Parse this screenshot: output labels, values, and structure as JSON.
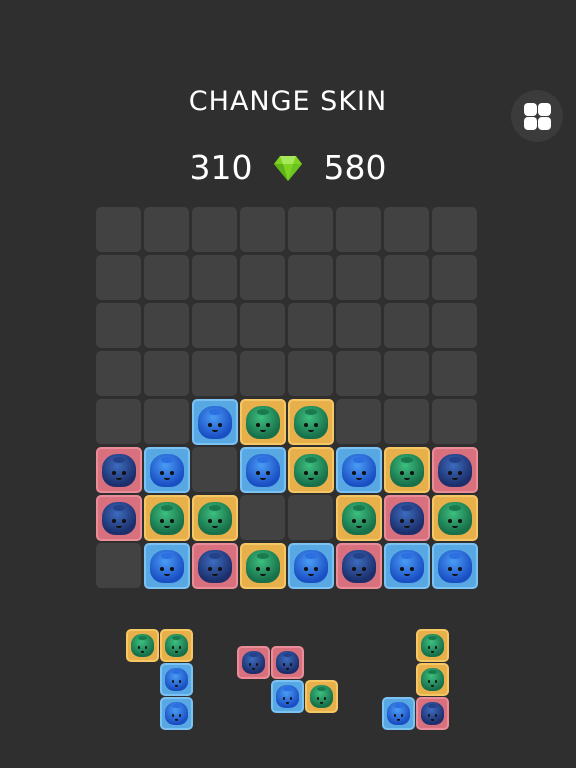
{
  "header": {
    "title": "CHANGE SKIN",
    "menu_icon": "grid-four-squares-icon",
    "left_score": "310",
    "gem_icon": "green-gem-icon",
    "right_score": "580"
  },
  "board": {
    "rows": 8,
    "cols": 8,
    "empty_cell_color": "#424242",
    "tiles": [
      {
        "row": 4,
        "col": 2,
        "skin": "blue-on-blue"
      },
      {
        "row": 4,
        "col": 3,
        "skin": "green-on-yellow"
      },
      {
        "row": 4,
        "col": 4,
        "skin": "green-on-yellow"
      },
      {
        "row": 5,
        "col": 0,
        "skin": "navy-on-pink"
      },
      {
        "row": 5,
        "col": 1,
        "skin": "blue-on-blue"
      },
      {
        "row": 5,
        "col": 3,
        "skin": "blue-on-blue"
      },
      {
        "row": 5,
        "col": 4,
        "skin": "green-on-yellow"
      },
      {
        "row": 5,
        "col": 5,
        "skin": "blue-on-blue"
      },
      {
        "row": 5,
        "col": 6,
        "skin": "green-on-yellow"
      },
      {
        "row": 5,
        "col": 7,
        "skin": "navy-on-pink"
      },
      {
        "row": 6,
        "col": 0,
        "skin": "navy-on-pink"
      },
      {
        "row": 6,
        "col": 1,
        "skin": "green-on-yellow"
      },
      {
        "row": 6,
        "col": 2,
        "skin": "green-on-yellow"
      },
      {
        "row": 6,
        "col": 5,
        "skin": "green-on-yellow"
      },
      {
        "row": 6,
        "col": 6,
        "skin": "navy-on-pink"
      },
      {
        "row": 6,
        "col": 7,
        "skin": "green-on-yellow"
      },
      {
        "row": 7,
        "col": 1,
        "skin": "blue-on-blue"
      },
      {
        "row": 7,
        "col": 2,
        "skin": "navy-on-pink"
      },
      {
        "row": 7,
        "col": 3,
        "skin": "green-on-yellow"
      },
      {
        "row": 7,
        "col": 4,
        "skin": "blue-on-blue"
      },
      {
        "row": 7,
        "col": 5,
        "skin": "navy-on-pink"
      },
      {
        "row": 7,
        "col": 6,
        "skin": "blue-on-blue"
      },
      {
        "row": 7,
        "col": 7,
        "skin": "blue-on-blue"
      }
    ]
  },
  "pieces": [
    {
      "name": "piece-1",
      "cells": [
        {
          "r": 0,
          "c": 0,
          "skin": "green-on-yellow"
        },
        {
          "r": 0,
          "c": 1,
          "skin": "green-on-yellow"
        },
        {
          "r": 1,
          "c": 1,
          "skin": "blue-on-blue"
        },
        {
          "r": 2,
          "c": 1,
          "skin": "blue-on-blue"
        }
      ]
    },
    {
      "name": "piece-2",
      "cells": [
        {
          "r": 0,
          "c": 0,
          "skin": "navy-on-pink"
        },
        {
          "r": 0,
          "c": 1,
          "skin": "navy-on-pink"
        },
        {
          "r": 1,
          "c": 1,
          "skin": "blue-on-blue"
        },
        {
          "r": 1,
          "c": 2,
          "skin": "green-on-yellow"
        }
      ]
    },
    {
      "name": "piece-3",
      "cells": [
        {
          "r": 0,
          "c": 1,
          "skin": "green-on-yellow"
        },
        {
          "r": 1,
          "c": 1,
          "skin": "green-on-yellow"
        },
        {
          "r": 2,
          "c": 0,
          "skin": "blue-on-blue"
        },
        {
          "r": 2,
          "c": 1,
          "skin": "navy-on-pink"
        }
      ]
    }
  ],
  "colors": {
    "background": "#2f2f2f",
    "tile_yellow": "#e8b04a",
    "tile_blue": "#58a8e4",
    "tile_pink": "#d9707e",
    "gem": "#7ed321"
  }
}
